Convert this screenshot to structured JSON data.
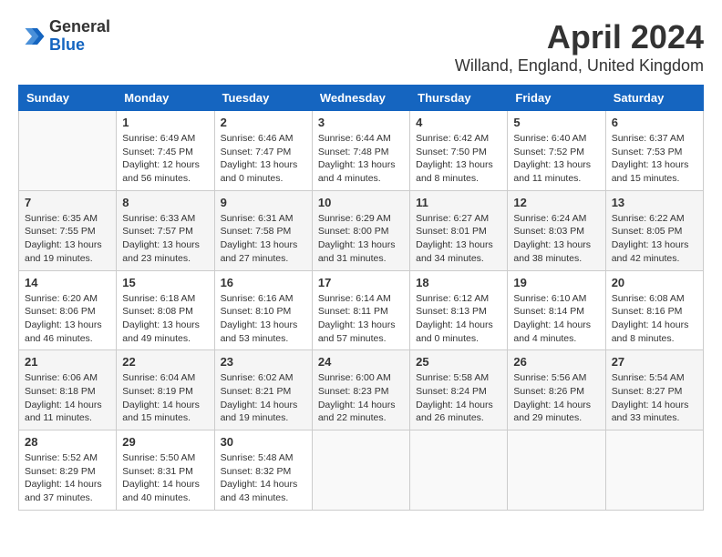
{
  "header": {
    "logo": {
      "general": "General",
      "blue": "Blue"
    },
    "title": "April 2024",
    "subtitle": "Willand, England, United Kingdom"
  },
  "calendar": {
    "days_of_week": [
      "Sunday",
      "Monday",
      "Tuesday",
      "Wednesday",
      "Thursday",
      "Friday",
      "Saturday"
    ],
    "weeks": [
      [
        {
          "day": "",
          "info": ""
        },
        {
          "day": "1",
          "info": "Sunrise: 6:49 AM\nSunset: 7:45 PM\nDaylight: 12 hours\nand 56 minutes."
        },
        {
          "day": "2",
          "info": "Sunrise: 6:46 AM\nSunset: 7:47 PM\nDaylight: 13 hours\nand 0 minutes."
        },
        {
          "day": "3",
          "info": "Sunrise: 6:44 AM\nSunset: 7:48 PM\nDaylight: 13 hours\nand 4 minutes."
        },
        {
          "day": "4",
          "info": "Sunrise: 6:42 AM\nSunset: 7:50 PM\nDaylight: 13 hours\nand 8 minutes."
        },
        {
          "day": "5",
          "info": "Sunrise: 6:40 AM\nSunset: 7:52 PM\nDaylight: 13 hours\nand 11 minutes."
        },
        {
          "day": "6",
          "info": "Sunrise: 6:37 AM\nSunset: 7:53 PM\nDaylight: 13 hours\nand 15 minutes."
        }
      ],
      [
        {
          "day": "7",
          "info": "Sunrise: 6:35 AM\nSunset: 7:55 PM\nDaylight: 13 hours\nand 19 minutes."
        },
        {
          "day": "8",
          "info": "Sunrise: 6:33 AM\nSunset: 7:57 PM\nDaylight: 13 hours\nand 23 minutes."
        },
        {
          "day": "9",
          "info": "Sunrise: 6:31 AM\nSunset: 7:58 PM\nDaylight: 13 hours\nand 27 minutes."
        },
        {
          "day": "10",
          "info": "Sunrise: 6:29 AM\nSunset: 8:00 PM\nDaylight: 13 hours\nand 31 minutes."
        },
        {
          "day": "11",
          "info": "Sunrise: 6:27 AM\nSunset: 8:01 PM\nDaylight: 13 hours\nand 34 minutes."
        },
        {
          "day": "12",
          "info": "Sunrise: 6:24 AM\nSunset: 8:03 PM\nDaylight: 13 hours\nand 38 minutes."
        },
        {
          "day": "13",
          "info": "Sunrise: 6:22 AM\nSunset: 8:05 PM\nDaylight: 13 hours\nand 42 minutes."
        }
      ],
      [
        {
          "day": "14",
          "info": "Sunrise: 6:20 AM\nSunset: 8:06 PM\nDaylight: 13 hours\nand 46 minutes."
        },
        {
          "day": "15",
          "info": "Sunrise: 6:18 AM\nSunset: 8:08 PM\nDaylight: 13 hours\nand 49 minutes."
        },
        {
          "day": "16",
          "info": "Sunrise: 6:16 AM\nSunset: 8:10 PM\nDaylight: 13 hours\nand 53 minutes."
        },
        {
          "day": "17",
          "info": "Sunrise: 6:14 AM\nSunset: 8:11 PM\nDaylight: 13 hours\nand 57 minutes."
        },
        {
          "day": "18",
          "info": "Sunrise: 6:12 AM\nSunset: 8:13 PM\nDaylight: 14 hours\nand 0 minutes."
        },
        {
          "day": "19",
          "info": "Sunrise: 6:10 AM\nSunset: 8:14 PM\nDaylight: 14 hours\nand 4 minutes."
        },
        {
          "day": "20",
          "info": "Sunrise: 6:08 AM\nSunset: 8:16 PM\nDaylight: 14 hours\nand 8 minutes."
        }
      ],
      [
        {
          "day": "21",
          "info": "Sunrise: 6:06 AM\nSunset: 8:18 PM\nDaylight: 14 hours\nand 11 minutes."
        },
        {
          "day": "22",
          "info": "Sunrise: 6:04 AM\nSunset: 8:19 PM\nDaylight: 14 hours\nand 15 minutes."
        },
        {
          "day": "23",
          "info": "Sunrise: 6:02 AM\nSunset: 8:21 PM\nDaylight: 14 hours\nand 19 minutes."
        },
        {
          "day": "24",
          "info": "Sunrise: 6:00 AM\nSunset: 8:23 PM\nDaylight: 14 hours\nand 22 minutes."
        },
        {
          "day": "25",
          "info": "Sunrise: 5:58 AM\nSunset: 8:24 PM\nDaylight: 14 hours\nand 26 minutes."
        },
        {
          "day": "26",
          "info": "Sunrise: 5:56 AM\nSunset: 8:26 PM\nDaylight: 14 hours\nand 29 minutes."
        },
        {
          "day": "27",
          "info": "Sunrise: 5:54 AM\nSunset: 8:27 PM\nDaylight: 14 hours\nand 33 minutes."
        }
      ],
      [
        {
          "day": "28",
          "info": "Sunrise: 5:52 AM\nSunset: 8:29 PM\nDaylight: 14 hours\nand 37 minutes."
        },
        {
          "day": "29",
          "info": "Sunrise: 5:50 AM\nSunset: 8:31 PM\nDaylight: 14 hours\nand 40 minutes."
        },
        {
          "day": "30",
          "info": "Sunrise: 5:48 AM\nSunset: 8:32 PM\nDaylight: 14 hours\nand 43 minutes."
        },
        {
          "day": "",
          "info": ""
        },
        {
          "day": "",
          "info": ""
        },
        {
          "day": "",
          "info": ""
        },
        {
          "day": "",
          "info": ""
        }
      ]
    ]
  }
}
